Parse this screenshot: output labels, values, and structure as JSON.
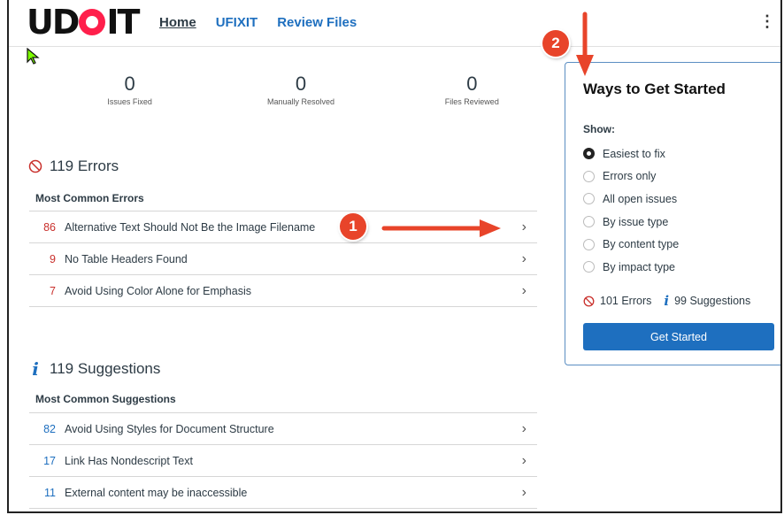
{
  "logo": "UDOIT",
  "nav": {
    "home": "Home",
    "ufixit": "UFIXIT",
    "review": "Review Files"
  },
  "kebab": "⋮",
  "stats": [
    {
      "value": "0",
      "label": "Issues Fixed"
    },
    {
      "value": "0",
      "label": "Manually Resolved"
    },
    {
      "value": "0",
      "label": "Files Reviewed"
    }
  ],
  "errors": {
    "title": "119 Errors",
    "subtitle": "Most Common Errors",
    "items": [
      {
        "count": "86",
        "label": "Alternative Text Should Not Be the Image Filename"
      },
      {
        "count": "9",
        "label": "No Table Headers Found"
      },
      {
        "count": "7",
        "label": "Avoid Using Color Alone for Emphasis"
      }
    ]
  },
  "suggestions": {
    "title": "119 Suggestions",
    "subtitle": "Most Common Suggestions",
    "items": [
      {
        "count": "82",
        "label": "Avoid Using Styles for Document Structure"
      },
      {
        "count": "17",
        "label": "Link Has Nondescript Text"
      },
      {
        "count": "11",
        "label": "External content may be inaccessible"
      }
    ]
  },
  "card": {
    "title": "Ways to Get Started",
    "show_label": "Show:",
    "options": [
      "Easiest to fix",
      "Errors only",
      "All open issues",
      "By issue type",
      "By content type",
      "By impact type"
    ],
    "selected": "Easiest to fix",
    "errors_tally": "101 Errors",
    "suggestions_tally": "99 Suggestions",
    "button": "Get Started"
  },
  "badges": {
    "one": "1",
    "two": "2"
  },
  "colors": {
    "accent": "#1e6fbf",
    "error": "#c9302c",
    "annotation": "#e8442a"
  }
}
